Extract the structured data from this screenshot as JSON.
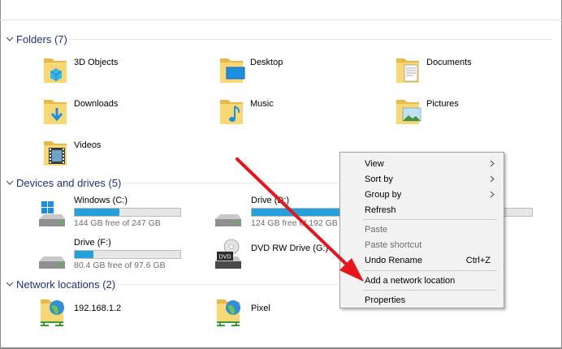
{
  "groups": {
    "folders": {
      "title": "Folders (7)"
    },
    "devices": {
      "title": "Devices and drives (5)"
    },
    "network": {
      "title": "Network locations (2)"
    }
  },
  "folders": [
    {
      "name": "3D Objects",
      "icon": "3d-objects-folder-icon"
    },
    {
      "name": "Desktop",
      "icon": "desktop-folder-icon"
    },
    {
      "name": "Documents",
      "icon": "documents-folder-icon"
    },
    {
      "name": "Downloads",
      "icon": "downloads-folder-icon"
    },
    {
      "name": "Music",
      "icon": "music-folder-icon"
    },
    {
      "name": "Pictures",
      "icon": "pictures-folder-icon"
    },
    {
      "name": "Videos",
      "icon": "videos-folder-icon"
    }
  ],
  "drives": [
    {
      "name": "Windows (C:)",
      "free": "144 GB free of 247 GB",
      "used_fraction": 0.42
    },
    {
      "name": "Drive (D:)",
      "free": "124 GB free of 192 GB",
      "used_fraction": 0.35
    },
    {
      "name": "Drive (F:)",
      "free": "80.4 GB free of 97.6 GB",
      "used_fraction": 0.18
    },
    {
      "name": "DVD RW Drive (G:)",
      "free": ""
    }
  ],
  "dvd_label": "DVD",
  "network_locations": [
    {
      "name": "192.168.1.2"
    },
    {
      "name": "Pixel"
    }
  ],
  "context_menu": {
    "view": "View",
    "sort_by": "Sort by",
    "group_by": "Group by",
    "refresh": "Refresh",
    "paste": "Paste",
    "paste_shortcut": "Paste shortcut",
    "undo_rename": "Undo Rename",
    "undo_rename_shortcut": "Ctrl+Z",
    "add_network_location": "Add a network location",
    "properties": "Properties"
  },
  "colors": {
    "group_title": "#1e3287",
    "drive_bar_fill": "#26a0da",
    "annotation_arrow": "#e8141b",
    "folder_yellow": "#f8d775"
  }
}
